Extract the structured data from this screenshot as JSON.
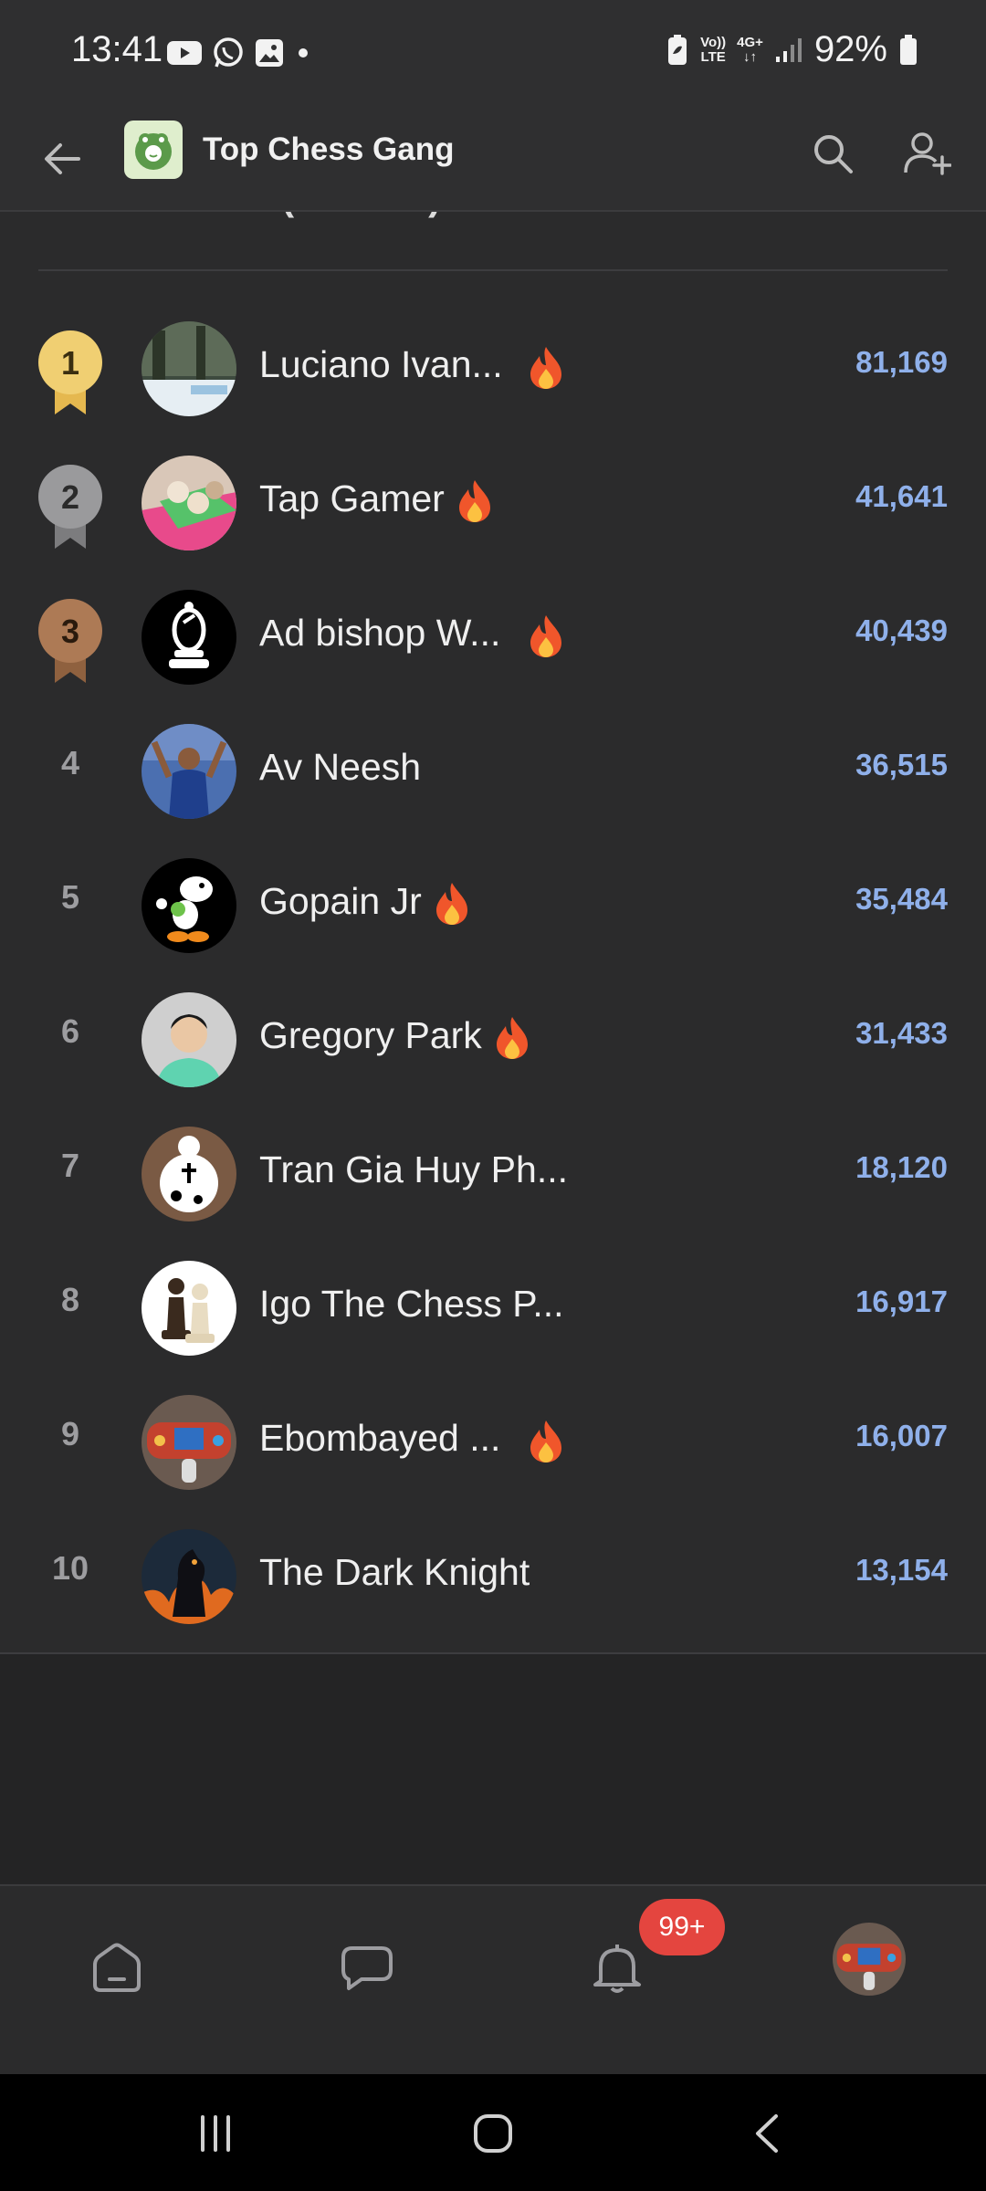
{
  "status_bar": {
    "time": "13:41",
    "battery": "92%",
    "network_top": "Vo))",
    "network_bottom": "LTE",
    "gen": "4G+"
  },
  "app_bar": {
    "title": "Top Chess Gang"
  },
  "leaderboard": {
    "heading": "Leaderboard (all-time)",
    "rows": [
      {
        "rank": "1",
        "name": "Luciano Ivan...",
        "score": "81,169",
        "fire": true
      },
      {
        "rank": "2",
        "name": "Tap Gamer",
        "score": "41,641",
        "fire": true
      },
      {
        "rank": "3",
        "name": "Ad bishop W...",
        "score": "40,439",
        "fire": true
      },
      {
        "rank": "4",
        "name": "Av Neesh",
        "score": "36,515",
        "fire": false
      },
      {
        "rank": "5",
        "name": "Gopain Jr",
        "score": "35,484",
        "fire": true
      },
      {
        "rank": "6",
        "name": "Gregory Park",
        "score": "31,433",
        "fire": true
      },
      {
        "rank": "7",
        "name": "Tran Gia Huy Ph...",
        "score": "18,120",
        "fire": false
      },
      {
        "rank": "8",
        "name": "Igo The Chess P...",
        "score": "16,917",
        "fire": false
      },
      {
        "rank": "9",
        "name": "Ebombayed ...",
        "score": "16,007",
        "fire": true
      },
      {
        "rank": "10",
        "name": "The Dark Knight",
        "score": "13,154",
        "fire": false
      }
    ]
  },
  "colors": {
    "gold": "#f0cf72",
    "silver": "#9a9a9c",
    "bronze": "#ad7a55",
    "score": "#8fb0ea",
    "badge": "#e4453f"
  },
  "bottom_nav": {
    "notification_badge": "99+"
  },
  "icons": [
    "back-arrow-icon",
    "search-icon",
    "add-user-icon",
    "fire-icon",
    "home-icon",
    "chat-icon",
    "bell-icon",
    "recent-apps-icon",
    "home-circle-icon",
    "system-back-icon"
  ]
}
